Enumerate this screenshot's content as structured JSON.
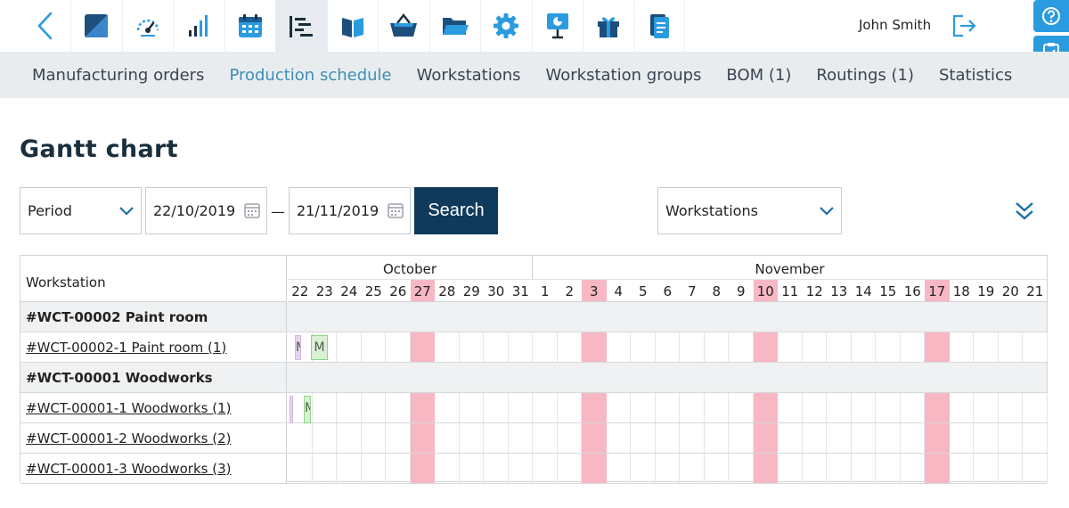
{
  "header": {
    "user_name": "John Smith",
    "icons": [
      "design-icon",
      "dashboard-icon",
      "statistics-icon",
      "calendar-icon",
      "schedule-icon",
      "book-icon",
      "basket-icon",
      "folder-icon",
      "settings-icon",
      "presentation-icon",
      "gift-icon",
      "documents-icon"
    ],
    "active_icon": "schedule-icon",
    "accent": "#2b9be0"
  },
  "subnav": {
    "tabs": [
      "Manufacturing orders",
      "Production schedule",
      "Workstations",
      "Workstation groups",
      "BOM (1)",
      "Routings (1)",
      "Statistics"
    ],
    "active": "Production schedule"
  },
  "page": {
    "title": "Gantt chart"
  },
  "filters": {
    "period_label": "Period",
    "date_from": "22/10/2019",
    "date_separator": "—",
    "date_to": "21/11/2019",
    "search_label": "Search",
    "view_label": "Workstations"
  },
  "gantt": {
    "column_header": "Workstation",
    "months": [
      "October",
      "November"
    ],
    "days": [
      "22",
      "23",
      "24",
      "25",
      "26",
      "27",
      "28",
      "29",
      "30",
      "31",
      "1",
      "2",
      "3",
      "4",
      "5",
      "6",
      "7",
      "8",
      "9",
      "10",
      "11",
      "12",
      "13",
      "14",
      "15",
      "16",
      "17",
      "18",
      "19",
      "20",
      "21"
    ],
    "highlight_days": [
      "27",
      "3",
      "10",
      "17"
    ],
    "highlight_color": "#f7b8c3",
    "rows": [
      {
        "type": "group",
        "label": "#WCT-00002 Paint room"
      },
      {
        "type": "item",
        "label": "#WCT-00002-1 Paint room (1)",
        "tasks": [
          {
            "color": "purple",
            "text": "M"
          },
          {
            "color": "green",
            "text": "M"
          }
        ]
      },
      {
        "type": "group",
        "label": "#WCT-00001 Woodworks"
      },
      {
        "type": "item",
        "label": "#WCT-00001-1 Woodworks (1)",
        "tasks": [
          {
            "color": "purple",
            "text": ""
          },
          {
            "color": "green",
            "text": "M"
          }
        ]
      },
      {
        "type": "item",
        "label": "#WCT-00001-2 Woodworks (2)",
        "tasks": []
      },
      {
        "type": "item",
        "label": "#WCT-00001-3 Woodworks (3)",
        "tasks": []
      }
    ]
  }
}
